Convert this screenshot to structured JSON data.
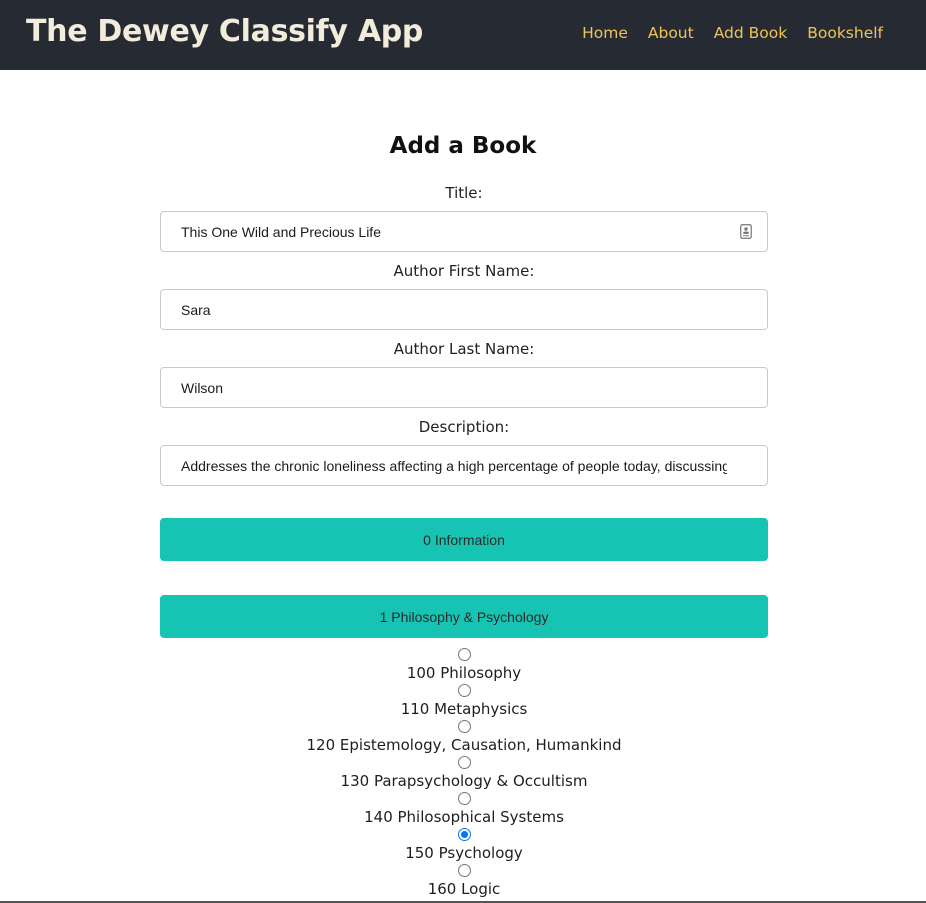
{
  "navbar": {
    "brand": "The Dewey Classify App",
    "links": [
      "Home",
      "About",
      "Add Book",
      "Bookshelf"
    ]
  },
  "form": {
    "heading": "Add a Book",
    "title_label": "Title:",
    "title_value": "This One Wild and Precious Life",
    "first_name_label": "Author First Name:",
    "first_name_value": "Sara",
    "last_name_label": "Author Last Name:",
    "last_name_value": "Wilson",
    "description_label": "Description:",
    "description_value": "Addresses the chronic loneliness affecting a high percentage of people today, discussing the vul"
  },
  "classes": [
    {
      "label": "0 Information"
    },
    {
      "label": "1 Philosophy & Psychology"
    }
  ],
  "subclasses": [
    {
      "label": "100 Philosophy",
      "checked": false
    },
    {
      "label": "110 Metaphysics",
      "checked": false
    },
    {
      "label": "120 Epistemology, Causation, Humankind",
      "checked": false
    },
    {
      "label": "130 Parapsychology & Occultism",
      "checked": false
    },
    {
      "label": "140 Philosophical Systems",
      "checked": false
    },
    {
      "label": "150 Psychology",
      "checked": true
    },
    {
      "label": "160 Logic",
      "checked": false
    }
  ],
  "colors": {
    "navbar_bg": "#262b33",
    "brand_text": "#f1ecdc",
    "nav_link": "#f0c35a",
    "class_button": "#17c3b2",
    "radio_selected": "#0a73ea"
  }
}
